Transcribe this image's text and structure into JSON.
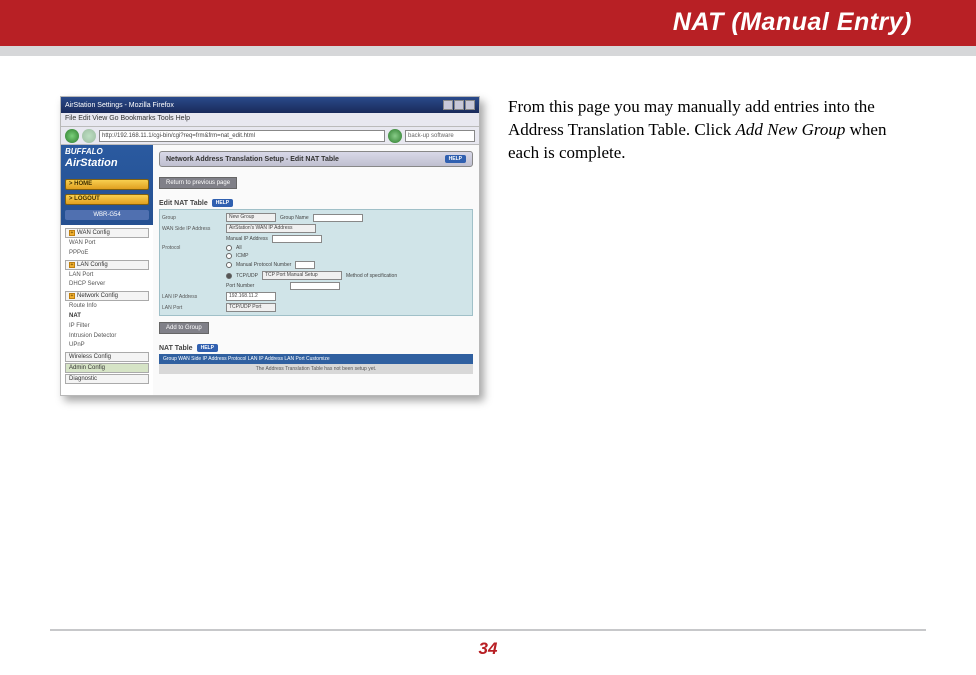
{
  "header": {
    "title": "NAT (Manual Entry)"
  },
  "body": {
    "text_before": "From this page you may manually add entries into the Address Translation Table.  Click ",
    "emphasis": "Add New Group",
    "text_after": " when each is complete."
  },
  "page_number": "34",
  "screenshot": {
    "window_title": "AirStation Settings - Mozilla Firefox",
    "menubar": "File  Edit  View  Go  Bookmarks  Tools  Help",
    "address": "http://192.168.11.1/cgi-bin/cgi?req=frm&frm=nat_edit.html",
    "search_placeholder": "back-up software",
    "logo_brand": "BUFFALO",
    "logo_product": "AirStation",
    "side_home": "HOME",
    "side_logout": "LOGOUT",
    "model": "WBR-G54",
    "nav": {
      "wan_config": "WAN Config",
      "wan_port": "WAN Port",
      "pppoe": "PPPoE",
      "lan_config": "LAN Config",
      "lan_port": "LAN Port",
      "dhcp": "DHCP Server",
      "network_config": "Network Config",
      "route": "Route Info",
      "nat": "NAT",
      "ipfilter": "IP Filter",
      "intrusion": "Intrusion Detector",
      "upnp": "UPnP",
      "wireless": "Wireless Config",
      "admin": "Admin Config",
      "diag": "Diagnostic"
    },
    "panel_title": "Network Address Translation Setup - Edit NAT Table",
    "help": "HELP",
    "return_btn": "Return to previous page",
    "edit_label": "Edit NAT Table",
    "rows": {
      "group": "Group",
      "group_dd": "New Group",
      "group_name": "Group Name",
      "wan_ip": "WAN Side IP Address",
      "wan_dd": "AirStation's WAN IP Address",
      "manual_ip": "Manual IP Address",
      "protocol": "Protocol",
      "proto_all": "All",
      "proto_icmp": "ICMP",
      "proto_manual": "Manual    Protocol Number",
      "proto_tcpudp": "TCP/UDP",
      "port_dd": "TCP Port Manual Setup",
      "port_spec": "Method of specification",
      "port_num": "Port Number",
      "lan_ip": "LAN IP Address",
      "lan_ip_val": "192.168.11.2",
      "lan_port": "LAN Port",
      "lan_port_dd": "TCP/UDP Port"
    },
    "add_btn": "Add to Group",
    "nat_table_label": "NAT Table",
    "table_headers": "Group  WAN Side IP Address  Protocol  LAN IP Address  LAN Port  Customize",
    "table_empty": "The Address Translation Table has not been setup yet."
  }
}
